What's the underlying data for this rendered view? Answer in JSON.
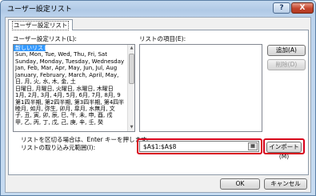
{
  "window": {
    "title": "ユーザー設定リスト",
    "help_label": "?",
    "close_label": "X"
  },
  "tab": {
    "label": "ユーザー設定リスト"
  },
  "lists": {
    "label": "ユーザー設定リスト(L):",
    "items": [
      "新しいリスト",
      "Sun, Mon, Tue, Wed, Thu, Fri, Sat",
      "Sunday, Monday, Tuesday, Wednesday",
      "Jan, Feb, Mar, Apr, May, Jun, Jul, Aug",
      "January, February, March, April, May, ",
      "日, 月, 火, 水, 木, 金, 土",
      "日曜日, 月曜日, 火曜日, 水曜日, 木曜日",
      "1月, 2月, 3月, 4月, 5月, 6月, 7月, 8月, 9",
      "第1四半期, 第2四半期, 第3四半期, 第4四半",
      "睦月, 如月, 弥生, 卯月, 皐月, 水無月, 文",
      "子, 丑, 寅, 卯, 辰, 巳, 午, 未, 申, 酉, 戌",
      "甲, 乙, 丙, 丁, 戊, 己, 庚, 辛, 壬, 癸"
    ],
    "selected_index": 0
  },
  "entries": {
    "label": "リストの項目(E):"
  },
  "buttons": {
    "add": "追加(A)",
    "delete": "削除(D)",
    "import": "インポート(M)",
    "ok": "OK",
    "cancel": "キャンセル"
  },
  "instructions": {
    "line1": "リストを区切る場合は、Enter キーを押します。",
    "line2": "リストの取り込み元範囲(I):"
  },
  "import_range": {
    "value": "$A$1:$A$8"
  },
  "colors": {
    "highlight": "#d9001b",
    "selection": "#3399ff"
  }
}
